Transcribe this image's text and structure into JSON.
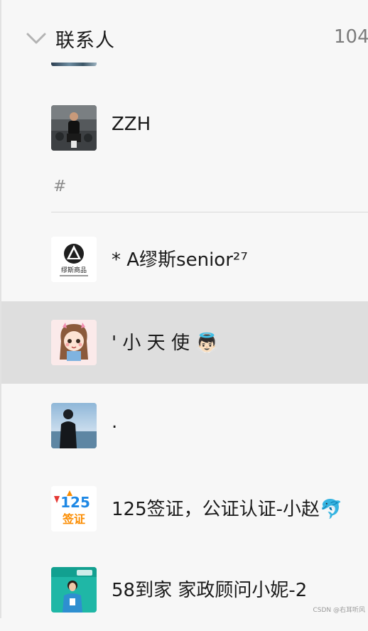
{
  "header": {
    "title": "联系人",
    "count": "104"
  },
  "section": {
    "letter": "#"
  },
  "contacts": [
    {
      "name": "ZZH",
      "avatar": "photo-man-gym"
    },
    {
      "name": "* A缪斯senior²⁷",
      "avatar": "muse-logo",
      "logo_text": "缪斯商品"
    },
    {
      "name": "' 小 天 使 👼🏻",
      "avatar": "cartoon-girl",
      "selected": true
    },
    {
      "name": ".",
      "avatar": "photo-man-beach"
    },
    {
      "name": "125签证，公证认证-小赵🐬",
      "avatar": "visa-125-logo",
      "logo_text_top": "125",
      "logo_text_bottom": "签证"
    },
    {
      "name": "58到家 家政顾问小妮-2",
      "avatar": "photo-staff"
    }
  ],
  "watermark": "CSDN @右耳听风",
  "colors": {
    "background": "#f7f7f7",
    "selected": "#dedede",
    "divider": "#dadada"
  }
}
